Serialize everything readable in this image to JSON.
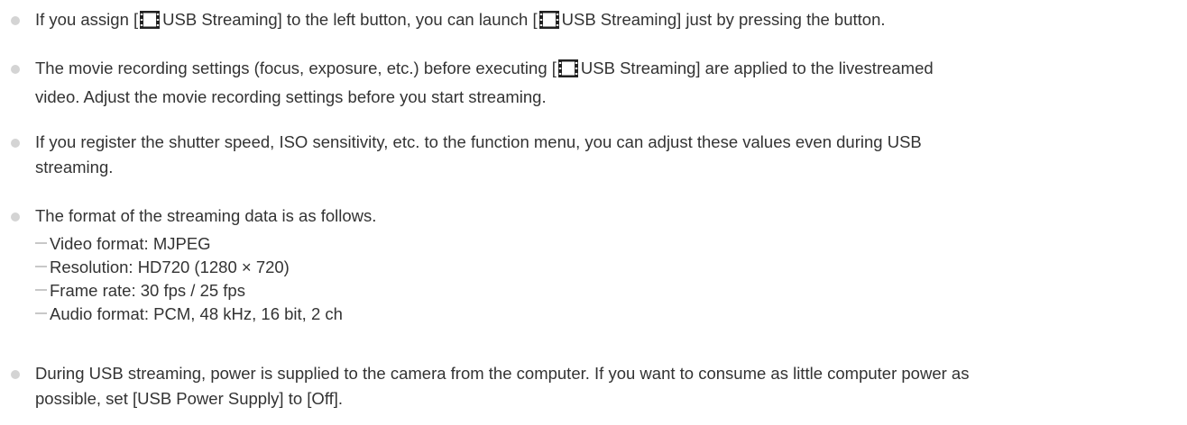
{
  "notes": [
    {
      "parts": [
        "If you assign [",
        "USB Streaming] to the left button, you can launch [",
        "USB Streaming] just by pressing the button."
      ]
    },
    {
      "line1": [
        "The movie recording settings (focus, exposure, etc.) before executing [",
        "USB Streaming] are applied to the livestreamed"
      ],
      "line2": "video. Adjust the movie recording settings before you start streaming."
    },
    {
      "line1": "If you register the shutter speed, ISO sensitivity, etc. to the function menu, you can adjust these values even during USB",
      "line2": "streaming."
    },
    {
      "line1": "The format of the streaming data is as follows.",
      "subitems": [
        "Video format: MJPEG",
        "Resolution: HD720 (1280 × 720)",
        "Frame rate: 30 fps / 25 fps",
        "Audio format: PCM, 48 kHz, 16 bit, 2 ch"
      ]
    },
    {
      "line1": "During USB streaming, power is supplied to the camera from the computer. If you want to consume as little computer power as",
      "line2": "possible, set [USB Power Supply] to [Off]."
    }
  ],
  "icons": {
    "movie_icon": "film-strip-icon",
    "bullet_color": "#d4d4d4",
    "text_color": "#333333"
  }
}
